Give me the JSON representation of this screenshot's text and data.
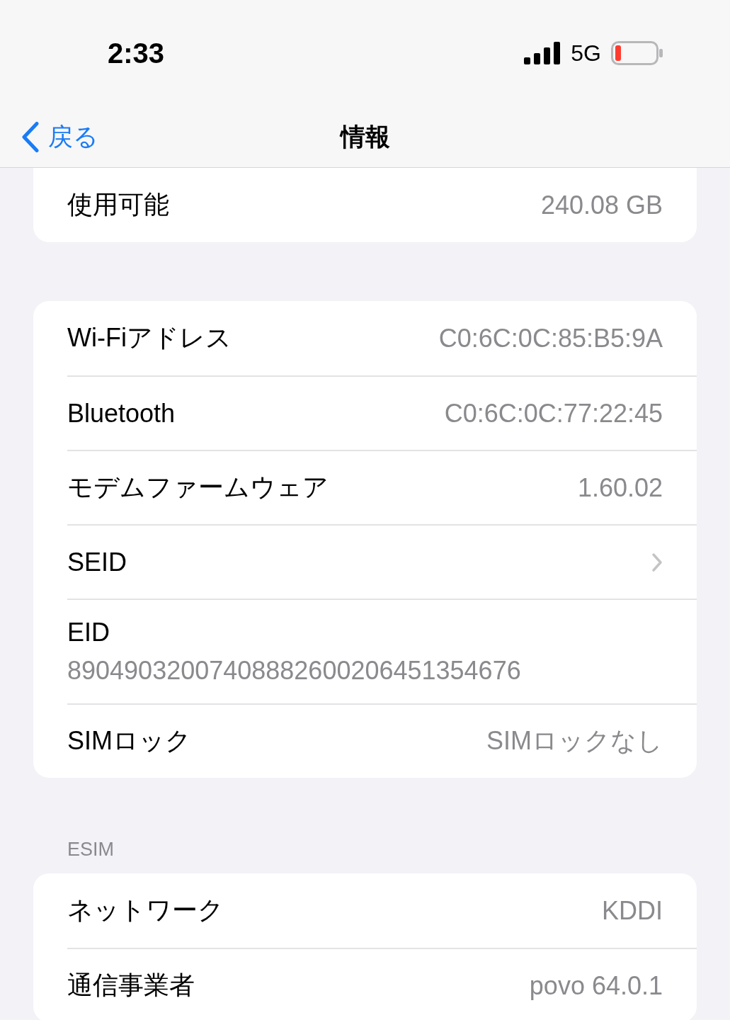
{
  "status_bar": {
    "time": "2:33",
    "network": "5G"
  },
  "nav": {
    "back": "戻る",
    "title": "情報"
  },
  "sections": [
    {
      "rows": [
        {
          "kind": "value",
          "label": "使用可能",
          "value": "240.08 GB"
        }
      ]
    },
    {
      "rows": [
        {
          "kind": "value",
          "label": "Wi-Fiアドレス",
          "value": "C0:6C:0C:85:B5:9A"
        },
        {
          "kind": "value",
          "label": "Bluetooth",
          "value": "C0:6C:0C:77:22:45"
        },
        {
          "kind": "value",
          "label": "モデムファームウェア",
          "value": "1.60.02"
        },
        {
          "kind": "chevron",
          "label": "SEID"
        },
        {
          "kind": "stacked",
          "label": "EID",
          "value": "89049032007408882600206451354676"
        },
        {
          "kind": "value",
          "label": "SIMロック",
          "value": "SIMロックなし"
        }
      ]
    },
    {
      "header": "ESIM",
      "rows": [
        {
          "kind": "value",
          "label": "ネットワーク",
          "value": "KDDI"
        },
        {
          "kind": "value",
          "label": "通信事業者",
          "value": "povo 64.0.1"
        }
      ]
    }
  ]
}
